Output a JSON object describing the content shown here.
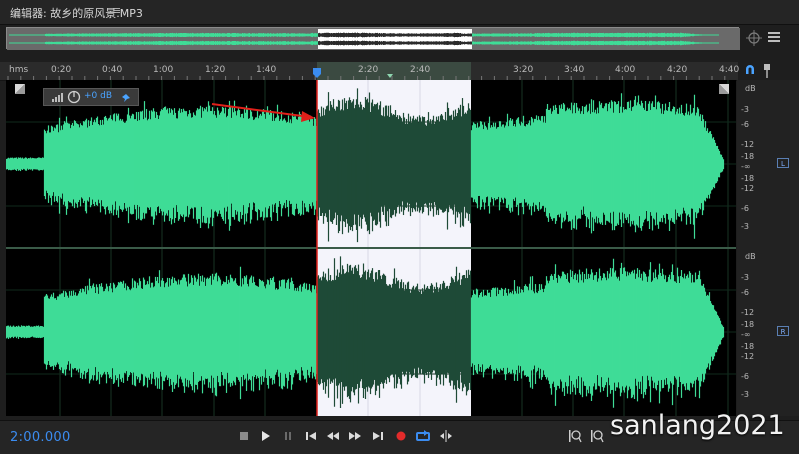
{
  "window": {
    "title": "编辑器: 故乡的原风景.MP3",
    "menu_icon": "hamburger-icon"
  },
  "ruler": {
    "unit": "hms",
    "labels": [
      "0:20",
      "0:40",
      "1:00",
      "1:20",
      "1:40",
      "2:20",
      "2:40",
      "3:20",
      "3:40",
      "4:00",
      "4:20",
      "4:40"
    ]
  },
  "hud": {
    "volume": "+0 dB"
  },
  "db_scale": {
    "upper": [
      "dB",
      "-3",
      "-6",
      "-12",
      "-18",
      "-∞",
      "-18",
      "-12",
      "-6",
      "-3"
    ],
    "lower": [
      "dB",
      "-3",
      "-6",
      "-12",
      "-18",
      "-∞",
      "-18",
      "-12",
      "-6",
      "-3"
    ],
    "channels": [
      "L",
      "R"
    ]
  },
  "transport": {
    "timecode": "2:00.000"
  },
  "watermark": "sanlang2021",
  "colors": {
    "wave": "#3fdc97",
    "wave_selected": "#1f4a37",
    "selection_bg": "#f3f3fb",
    "accent_blue": "#3b8cf0",
    "arrow_red": "#e0201a",
    "record_red": "#e32b2b"
  }
}
